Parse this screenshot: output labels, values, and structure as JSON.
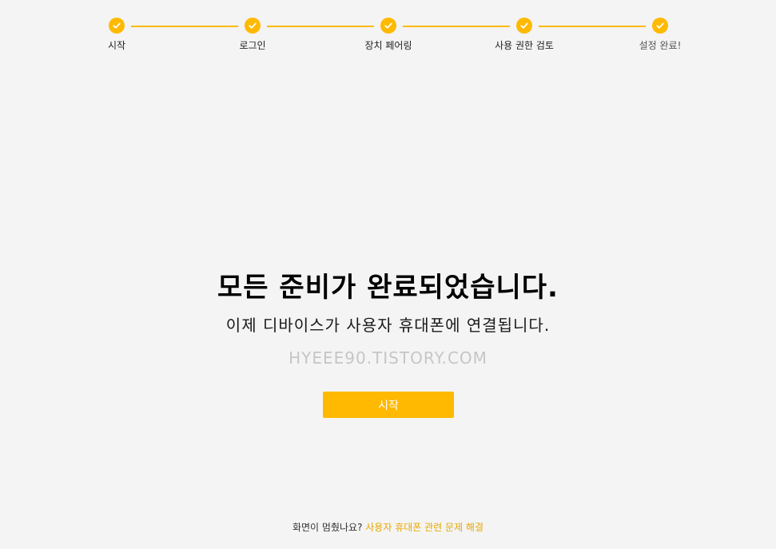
{
  "stepper": {
    "steps": [
      {
        "label": "시작",
        "completed": true
      },
      {
        "label": "로그인",
        "completed": true
      },
      {
        "label": "장치 페어링",
        "completed": true
      },
      {
        "label": "사용 권한 검토",
        "completed": true
      },
      {
        "label": "설정 완료!",
        "completed": true
      }
    ],
    "accent_color": "#ffb900"
  },
  "main": {
    "title": "모든 준비가 완료되었습니다.",
    "subtitle": "이제 디바이스가 사용자 휴대폰에 연결됩니다.",
    "watermark": "HYEEE90.TISTORY.COM",
    "start_button_label": "시작"
  },
  "footer": {
    "question": "화면이 멈췄나요?",
    "link_label": "사용자 휴대폰 관련 문제 해결"
  }
}
